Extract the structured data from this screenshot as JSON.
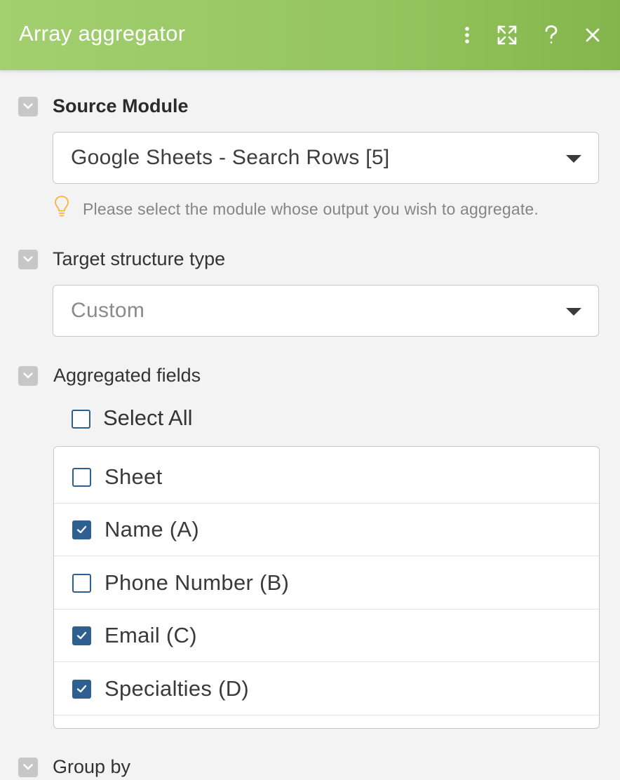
{
  "header": {
    "title": "Array aggregator",
    "accent_color": "#95c55e",
    "icons": [
      "more-vertical-icon",
      "expand-icon",
      "help-icon",
      "close-icon"
    ]
  },
  "source_module": {
    "label": "Source Module",
    "value": "Google Sheets - Search Rows [5]",
    "hint_icon": "lightbulb-icon",
    "hint": "Please select the module whose output you wish to aggregate."
  },
  "target_structure": {
    "label": "Target structure type",
    "value": "Custom"
  },
  "aggregated_fields": {
    "label": "Aggregated fields",
    "select_all_label": "Select All",
    "select_all_checked": false,
    "fields": [
      {
        "label": "Sheet",
        "checked": false
      },
      {
        "label": "Name (A)",
        "checked": true
      },
      {
        "label": "Phone Number (B)",
        "checked": false
      },
      {
        "label": "Email (C)",
        "checked": true
      },
      {
        "label": "Specialties (D)",
        "checked": true
      }
    ]
  },
  "group_by": {
    "label": "Group by"
  },
  "colors": {
    "checkbox": "#2d5f91",
    "toggle": "#c7c7c7",
    "background": "#f3f3f3"
  }
}
